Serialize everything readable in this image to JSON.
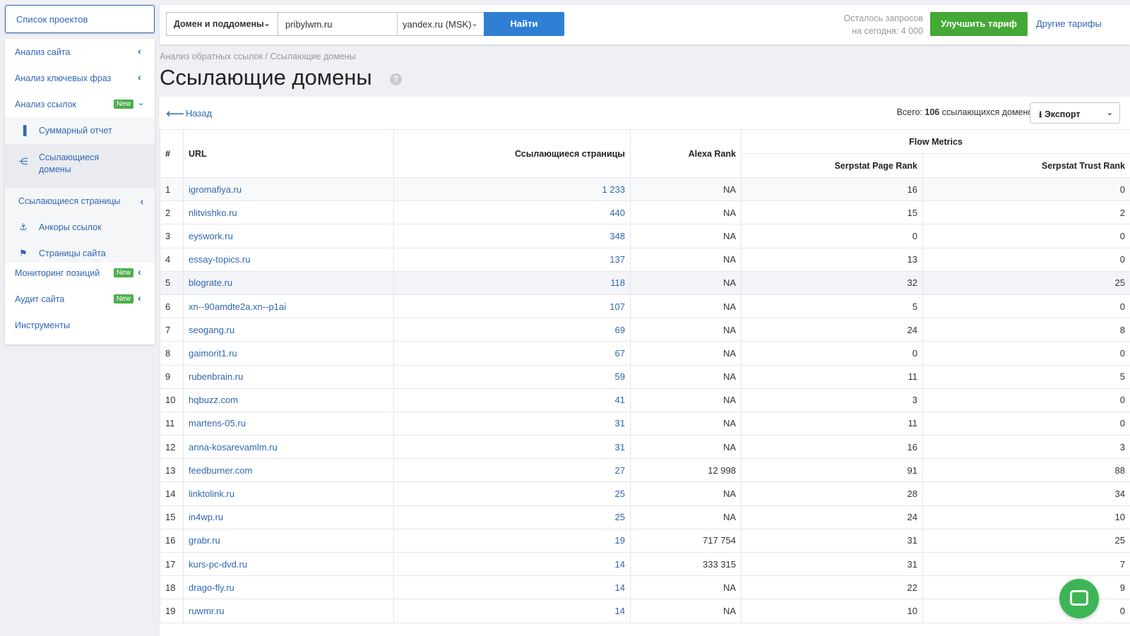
{
  "sidebar": {
    "projects_button": "Список проектов",
    "items": [
      {
        "label": "Анализ сайта"
      },
      {
        "label": "Анализ ключевых фраз"
      },
      {
        "label": "Анализ ссылок",
        "badge": "New"
      }
    ],
    "sub_items": [
      {
        "label": "Суммарный отчет",
        "icon": "bar-chart-icon"
      },
      {
        "label": "Ссылающиеся домены",
        "icon": "share-icon"
      },
      {
        "label": "Ссылающиеся страницы"
      },
      {
        "label": "Анкоры ссылок",
        "icon": "anchor-icon"
      },
      {
        "label": "Страницы сайта",
        "icon": "flag-icon"
      }
    ],
    "items_after": [
      {
        "label": "Мониторинг позиций",
        "badge": "New"
      },
      {
        "label": "Аудит сайта",
        "badge": "New"
      },
      {
        "label": "Инструменты"
      }
    ]
  },
  "topbar": {
    "scope": "Домен и поддомены",
    "domain": "pribylwm.ru",
    "database": "yandex.ru (MSK)",
    "find": "Найти",
    "quota_line1": "Осталось запросов",
    "quota_line2": "на сегодня: 4 000",
    "upgrade": "Улучшить тариф",
    "other_plans": "Другие тарифы"
  },
  "breadcrumb": "Анализ обратных ссылок / Ссылающие домены",
  "title": "Ссылающие домены",
  "toolbar": {
    "back": "Назад",
    "total_prefix": "Всего:",
    "total_count": "106",
    "total_suffix": "ссылающихся доменов",
    "export": "Экспорт"
  },
  "table": {
    "headers": {
      "idx": "#",
      "url": "URL",
      "pages": "Ссылающиеся страницы",
      "alexa": "Alexa Rank",
      "flow": "Flow Metrics",
      "page_rank": "Serpstat Page Rank",
      "trust_rank": "Serpstat Trust Rank"
    },
    "rows": [
      [
        "1",
        "igromafiya.ru",
        "1 233",
        "NA",
        "16",
        "0"
      ],
      [
        "2",
        "nlitvishko.ru",
        "440",
        "NA",
        "15",
        "2"
      ],
      [
        "3",
        "eyswork.ru",
        "348",
        "NA",
        "0",
        "0"
      ],
      [
        "4",
        "essay-topics.ru",
        "137",
        "NA",
        "13",
        "0"
      ],
      [
        "5",
        "blograte.ru",
        "118",
        "NA",
        "32",
        "25"
      ],
      [
        "6",
        "xn--90amdte2a.xn--p1ai",
        "107",
        "NA",
        "5",
        "0"
      ],
      [
        "7",
        "seogang.ru",
        "69",
        "NA",
        "24",
        "8"
      ],
      [
        "8",
        "gaimorit1.ru",
        "67",
        "NA",
        "0",
        "0"
      ],
      [
        "9",
        "rubenbrain.ru",
        "59",
        "NA",
        "11",
        "5"
      ],
      [
        "10",
        "hqbuzz.com",
        "41",
        "NA",
        "3",
        "0"
      ],
      [
        "11",
        "martens-05.ru",
        "31",
        "NA",
        "11",
        "0"
      ],
      [
        "12",
        "anna-kosarevamlm.ru",
        "31",
        "NA",
        "16",
        "3"
      ],
      [
        "13",
        "feedburner.com",
        "27",
        "12 998",
        "91",
        "88"
      ],
      [
        "14",
        "linktolink.ru",
        "25",
        "NA",
        "28",
        "34"
      ],
      [
        "15",
        "in4wp.ru",
        "25",
        "NA",
        "24",
        "10"
      ],
      [
        "16",
        "grabr.ru",
        "19",
        "717 754",
        "31",
        "25"
      ],
      [
        "17",
        "kurs-pc-dvd.ru",
        "14",
        "333 315",
        "31",
        "7"
      ],
      [
        "18",
        "drago-fly.ru",
        "14",
        "NA",
        "22",
        "9"
      ],
      [
        "19",
        "ruwmr.ru",
        "14",
        "NA",
        "10",
        "0"
      ]
    ]
  }
}
